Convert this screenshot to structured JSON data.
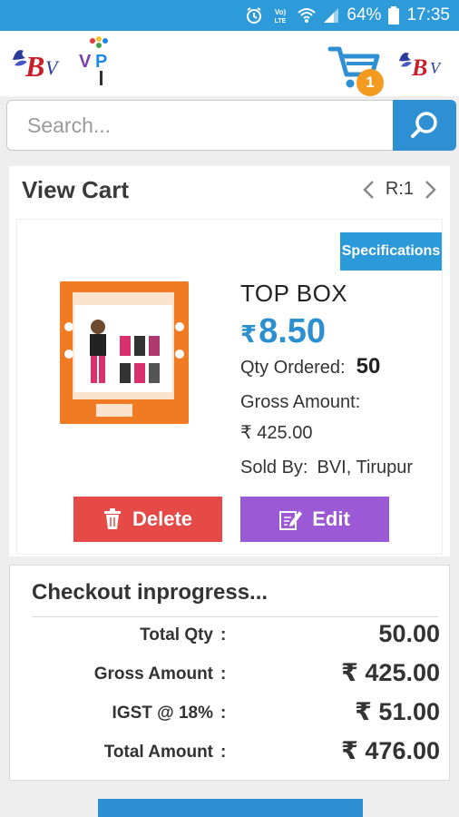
{
  "status_bar": {
    "battery": "64%",
    "time": "17:35",
    "volte_label": "VoLTE"
  },
  "header": {
    "logo_left": "BV",
    "logo_vp": "VP",
    "cart_count": "1",
    "logo_right": "BV"
  },
  "search": {
    "placeholder": "Search..."
  },
  "view_cart": {
    "title": "View Cart",
    "page_label": "R:1",
    "item": {
      "spec_label": "Specifications",
      "name": "TOP BOX",
      "price_symbol": "₹",
      "price": "8.50",
      "qty_label": "Qty Ordered:",
      "qty_value": "50",
      "gross_label": "Gross Amount:",
      "gross_value": "₹ 425.00",
      "sold_by_label": "Sold By:",
      "sold_by_value": "BVI, Tirupur",
      "delete_label": "Delete",
      "edit_label": "Edit"
    }
  },
  "checkout": {
    "title": "Checkout inprogress...",
    "rows": [
      {
        "label": "Total Qty",
        "colon": ":",
        "value": "50.00"
      },
      {
        "label": "Gross Amount",
        "colon": ":",
        "value": "₹ 425.00"
      },
      {
        "label": "IGST @ 18%",
        "colon": ":",
        "value": "₹ 51.00"
      },
      {
        "label": "Total Amount",
        "colon": ":",
        "value": "₹ 476.00"
      }
    ]
  },
  "colors": {
    "status_bar": "#2d9bd9",
    "accent_blue": "#2c8fd0",
    "delete_red": "#e54a46",
    "edit_purple": "#9b59d6",
    "badge_orange": "#f39a1f",
    "product_orange": "#f07b22"
  }
}
